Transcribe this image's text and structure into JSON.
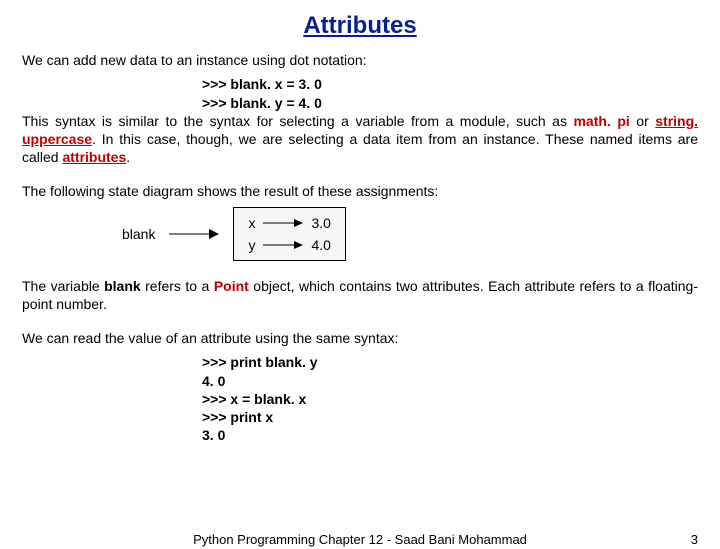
{
  "title": "Attributes",
  "p1_lead": "We can add new data to an instance using dot notation:",
  "code1_a": ">>> blank. x = 3. 0",
  "code1_b": ">>> blank. y = 4. 0",
  "p2_a": "This syntax is similar to the syntax for selecting a variable from a module, such as ",
  "p2_mathpi": "math. pi",
  "p2_b": " or ",
  "p2_stru": "string. uppercase",
  "p2_c": ". In this case, though, we are selecting a data item from an instance. These named items are called ",
  "p2_attr": "attributes",
  "p2_d": ".",
  "p3": "The following state diagram shows the result of these assignments:",
  "diagram": {
    "label": "blank",
    "rows": [
      {
        "name": "x",
        "val": "3.0"
      },
      {
        "name": "y",
        "val": "4.0"
      }
    ]
  },
  "p4_a": "The variable ",
  "p4_blank": "blank",
  "p4_b": " refers to a ",
  "p4_point": "Point",
  "p4_c": " object, which contains two attributes. Each attribute refers to a floating-point number.",
  "p5": "We can read the value of an attribute using the same syntax:",
  "code2": [
    ">>> print blank. y",
    "4. 0",
    ">>> x = blank. x",
    ">>> print x",
    "3. 0"
  ],
  "footer_center": "Python Programming Chapter 12 - Saad Bani Mohammad",
  "footer_page": "3"
}
